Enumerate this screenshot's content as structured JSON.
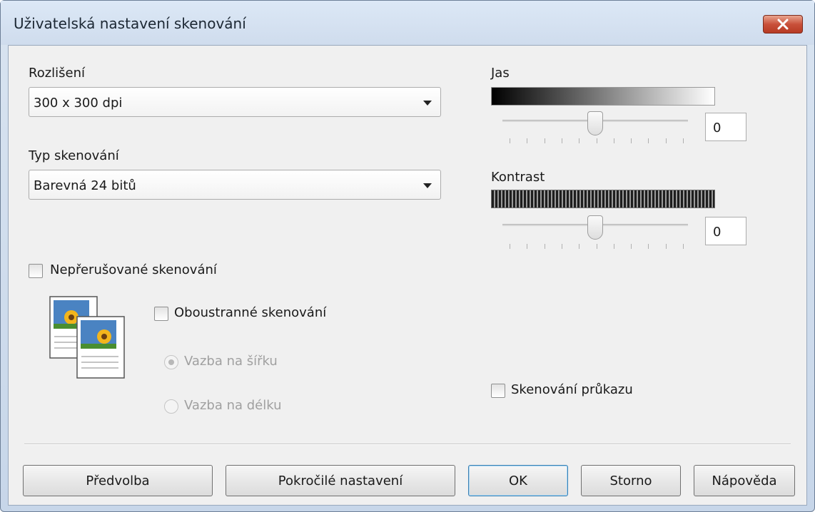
{
  "window": {
    "title": "Uživatelská nastavení skenování"
  },
  "resolution": {
    "label": "Rozlišení",
    "value": "300 x 300 dpi"
  },
  "scan_type": {
    "label": "Typ skenování",
    "value": "Barevná 24 bitů"
  },
  "brightness": {
    "label": "Jas",
    "value": "0",
    "level": 0.5
  },
  "contrast": {
    "label": "Kontrast",
    "value": "0",
    "level": 0.5
  },
  "continuous_scan": {
    "label": "Nepřerušované skenování",
    "checked": false
  },
  "duplex_scan": {
    "label": "Oboustranné skenování",
    "checked": false
  },
  "binding": {
    "long_edge_label": "Vazba na šířku",
    "short_edge_label": "Vazba na délku",
    "selected": "long_edge",
    "enabled": false
  },
  "id_card_scan": {
    "label": "Skenování průkazu",
    "checked": false
  },
  "buttons": {
    "preset": "Předvolba",
    "advanced": "Pokročilé nastavení",
    "ok": "OK",
    "cancel": "Storno",
    "help": "Nápověda"
  },
  "colors": {
    "accent": "#3c7fb1",
    "close": "#c9503a",
    "dialog_bg": "#f0f0f0"
  },
  "icons": {
    "close": "close-icon",
    "duplex_document": "duplex-document-icon"
  }
}
